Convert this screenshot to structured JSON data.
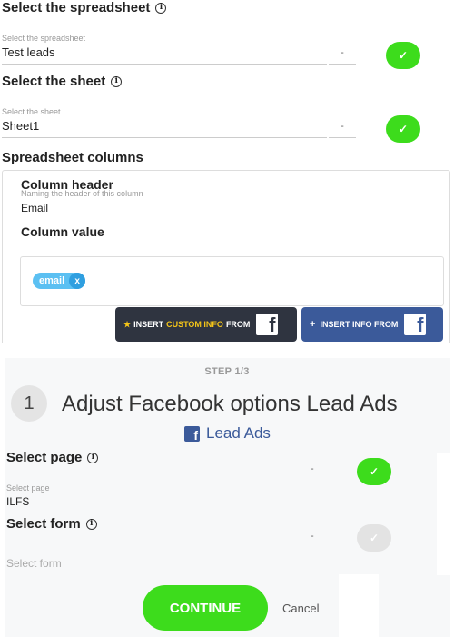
{
  "spreadsheet": {
    "title": "Select the spreadsheet",
    "field_label": "Select the spreadsheet",
    "value": "Test leads",
    "dash": "-",
    "check": "✓"
  },
  "sheet": {
    "title": "Select the sheet",
    "field_label": "Select the sheet",
    "value": "Sheet1",
    "dash": "-",
    "check": "✓"
  },
  "columns": {
    "title": "Spreadsheet columns",
    "header_title": "Column header",
    "header_label": "Naming the header of this column",
    "header_value": "Email",
    "value_title": "Column value",
    "tag_label": "email",
    "tag_remove": "x",
    "insert_custom": {
      "star": "★",
      "prefix": "INSERT",
      "accent": "CUSTOM INFO",
      "suffix": "FROM",
      "fb": "f"
    },
    "insert_info": {
      "plus": "+",
      "label": "INSERT INFO FROM",
      "fb": "f"
    }
  },
  "step": {
    "label": "STEP 1/3",
    "number": "1",
    "title": "Adjust Facebook options Lead Ads",
    "app_icon": "f",
    "app_name": "Lead Ads"
  },
  "page_select": {
    "title": "Select page",
    "field_label": "Select page",
    "value": "ILFS",
    "dash": "-",
    "check": "✓"
  },
  "form_select": {
    "title": "Select form",
    "placeholder": "Select form",
    "dash": "-",
    "check": "✓"
  },
  "actions": {
    "continue": "CONTINUE",
    "cancel": "Cancel"
  },
  "colors": {
    "green": "#3ddc1c",
    "facebook_blue": "#3b5a9a",
    "dark": "#2f3440",
    "tag_blue": "#5bc0f2"
  }
}
